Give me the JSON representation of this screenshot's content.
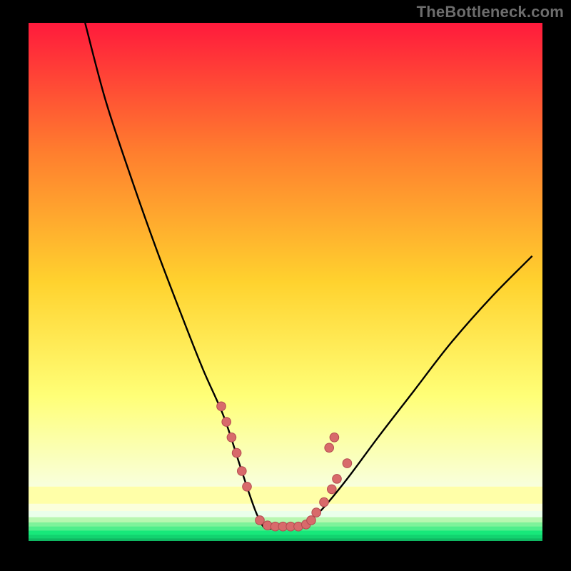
{
  "watermark": "TheBottleneck.com",
  "colors": {
    "black": "#000000",
    "curve": "#000000",
    "dot_fill": "#d86a6b",
    "dot_stroke": "#b34a50",
    "grad_top": "#ff1a3c",
    "grad_mid1": "#ff7e2e",
    "grad_mid2": "#ffd22e",
    "grad_mid3": "#ffff77",
    "grad_mid4": "#f8ffe0",
    "grad_bottom": "#17e87a",
    "band_pale_yellow": "#ffffa8",
    "band_cream": "#fbffdc",
    "band_green_light": "#b8f7b0",
    "band_green": "#17e87a"
  },
  "chart_data": {
    "type": "line",
    "title": "",
    "xlabel": "",
    "ylabel": "",
    "xlim": [
      0,
      100
    ],
    "ylim": [
      0,
      100
    ],
    "legend": false,
    "grid": false,
    "notes": "V-shaped bottleneck curve overlaid on a vertical red→yellow→green gradient. Y represents some 'bottleneck %' (top = high). Scatter points cluster around the curve near the minimum region.",
    "series": [
      {
        "name": "bottleneck-curve",
        "x": [
          11,
          15,
          20,
          25,
          30,
          34,
          38,
          41,
          43,
          44.5,
          46,
          48,
          50,
          52,
          54,
          57,
          62,
          68,
          75,
          82,
          90,
          98
        ],
        "y": [
          100,
          85,
          70,
          56,
          43,
          33,
          24,
          15,
          9,
          5,
          2.5,
          2.5,
          2.5,
          2.5,
          3.5,
          6,
          12,
          20,
          29,
          38,
          47,
          55
        ]
      }
    ],
    "scatter": [
      {
        "name": "measurement-points",
        "points": [
          {
            "x": 37.5,
            "y": 26
          },
          {
            "x": 38.5,
            "y": 23
          },
          {
            "x": 39.5,
            "y": 20
          },
          {
            "x": 40.5,
            "y": 17
          },
          {
            "x": 41.5,
            "y": 13.5
          },
          {
            "x": 42.5,
            "y": 10.5
          },
          {
            "x": 45,
            "y": 4
          },
          {
            "x": 46.5,
            "y": 3
          },
          {
            "x": 48,
            "y": 2.8
          },
          {
            "x": 49.5,
            "y": 2.8
          },
          {
            "x": 51,
            "y": 2.8
          },
          {
            "x": 52.5,
            "y": 2.8
          },
          {
            "x": 54,
            "y": 3.2
          },
          {
            "x": 55,
            "y": 4
          },
          {
            "x": 56,
            "y": 5.5
          },
          {
            "x": 57.5,
            "y": 7.5
          },
          {
            "x": 59,
            "y": 10
          },
          {
            "x": 60,
            "y": 12
          },
          {
            "x": 62,
            "y": 15
          },
          {
            "x": 58.5,
            "y": 18
          },
          {
            "x": 59.5,
            "y": 20
          }
        ]
      }
    ]
  }
}
